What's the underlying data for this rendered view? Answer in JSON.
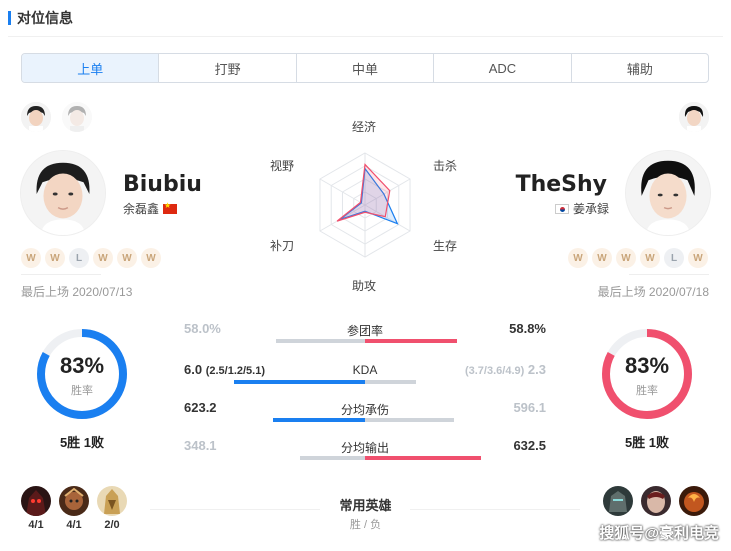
{
  "section_title": "对位信息",
  "tabs": [
    "上单",
    "打野",
    "中单",
    "ADC",
    "辅助"
  ],
  "radar": {
    "labels": [
      "经济",
      "击杀",
      "生存",
      "助攻",
      "补刀",
      "视野"
    ],
    "left_color": "#1a7ff0",
    "right_color": "#f0506e"
  },
  "left_player": {
    "name": "Biubiu",
    "real_name": "余磊鑫",
    "results": [
      "W",
      "W",
      "L",
      "W",
      "W",
      "W"
    ],
    "last_played": "最后上场 2020/07/13",
    "win_rate": "83%",
    "win_rate_value": 0.83,
    "win_rate_label": "胜率",
    "record": "5胜 1败",
    "color": "#1a7ff0",
    "heroes": [
      {
        "score": "4/1",
        "icon": "hero-dark-icon"
      },
      {
        "score": "4/1",
        "icon": "hero-warrior-icon"
      },
      {
        "score": "2/0",
        "icon": "hero-gold-icon"
      }
    ]
  },
  "right_player": {
    "name": "TheShy",
    "real_name": "姜承録",
    "results": [
      "W",
      "W",
      "W",
      "W",
      "L",
      "W"
    ],
    "last_played": "最后上场 2020/07/18",
    "win_rate": "83%",
    "win_rate_value": 0.83,
    "win_rate_label": "胜率",
    "record": "5胜 1败",
    "color": "#f0506e",
    "heroes": [
      {
        "icon": "hero-armor-icon"
      },
      {
        "icon": "hero-mask-icon"
      },
      {
        "icon": "hero-fire-icon"
      }
    ]
  },
  "stats": [
    {
      "label": "参团率",
      "left": "58.0%",
      "right": "58.8%",
      "left_frac": 0.49,
      "right_frac": 0.51,
      "winner": "right"
    },
    {
      "label": "KDA",
      "left": "6.0",
      "left_detail": "(2.5/1.2/5.1)",
      "right": "2.3",
      "right_detail": "(3.7/3.6/4.9)",
      "left_frac": 0.72,
      "right_frac": 0.28,
      "winner": "left"
    },
    {
      "label": "分均承伤",
      "left": "623.2",
      "right": "596.1",
      "left_frac": 0.51,
      "right_frac": 0.49,
      "winner": "left"
    },
    {
      "label": "分均输出",
      "left": "348.1",
      "right": "632.5",
      "left_frac": 0.36,
      "right_frac": 0.64,
      "winner": "right"
    }
  ],
  "common_heroes": {
    "title": "常用英雄",
    "subtitle": "胜 / 负"
  },
  "watermark": "搜狐号@豪利电竞"
}
